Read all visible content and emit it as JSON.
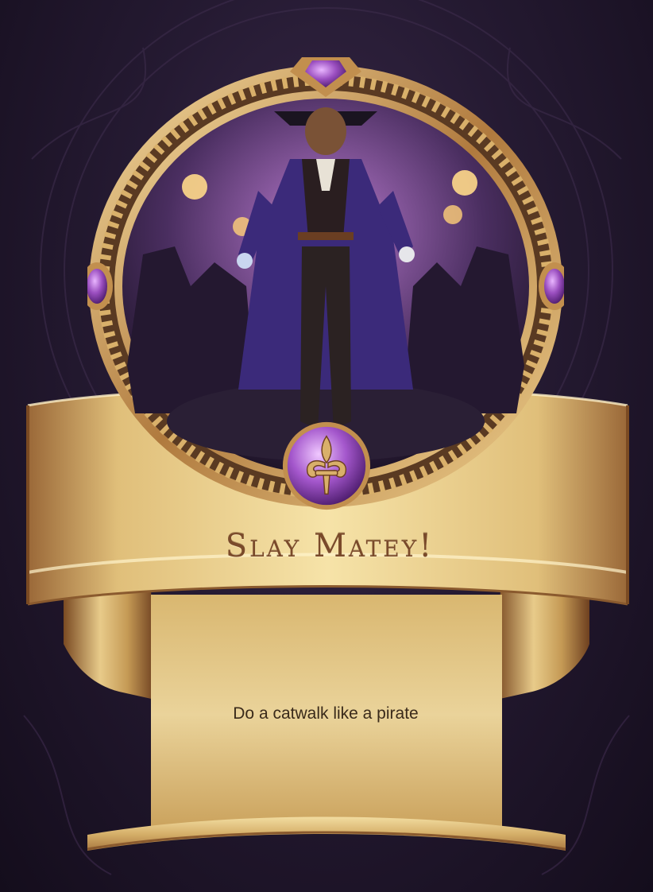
{
  "card": {
    "title": "Slay Matey!",
    "prompt": "Do a catwalk like a pirate"
  },
  "icons": {
    "top_gem": "amethyst-gem-icon",
    "side_gems": "amethyst-gem-icon",
    "center_emblem": "fleur-de-lis-gem-icon",
    "portrait": "pirate-illustration"
  },
  "colors": {
    "background": "#251a32",
    "gold_light": "#f3dfa0",
    "gold_dark": "#8a5a2e",
    "amethyst": "#9b4fc0",
    "title_text": "#7a4a2a",
    "prompt_text": "#3a2a1a"
  }
}
